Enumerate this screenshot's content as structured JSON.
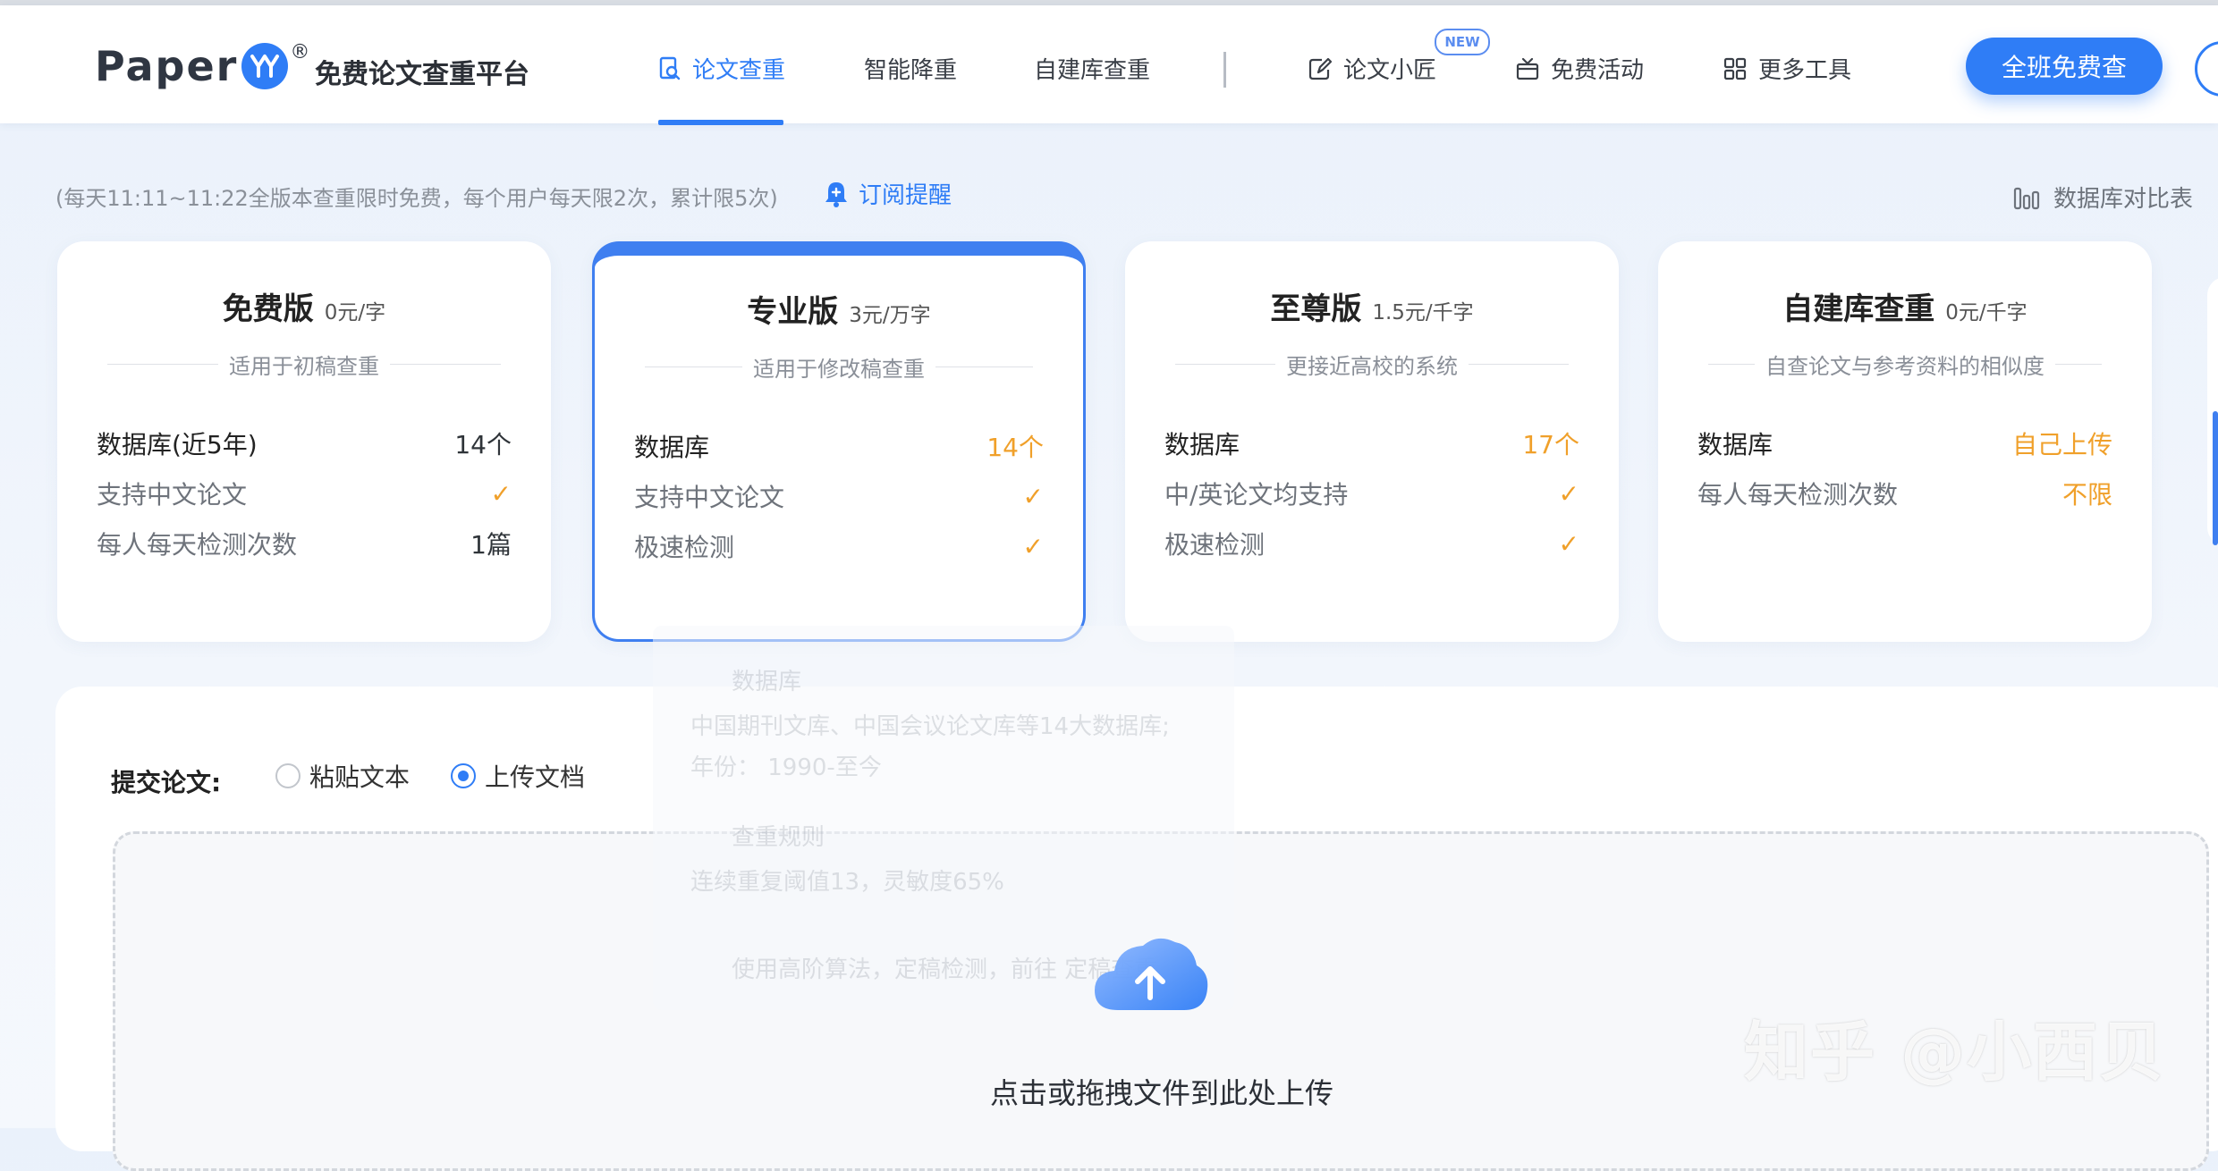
{
  "header": {
    "logo_text": "Paper",
    "slogan": "免费论文查重平台",
    "nav": [
      {
        "label": "论文查重",
        "active": true
      },
      {
        "label": "智能降重"
      },
      {
        "label": "自建库查重"
      },
      {
        "label": "论文小匠",
        "badge": "NEW"
      },
      {
        "label": "免费活动"
      },
      {
        "label": "更多工具"
      }
    ],
    "cta_label": "全班免费查"
  },
  "notice": {
    "text": "(每天11:11~11:22全版本查重限时免费，每个用户每天限2次，累计限5次)",
    "subscribe_label": "订阅提醒",
    "db_compare_label": "数据库对比表"
  },
  "plans": [
    {
      "name": "免费版",
      "price": "0元/字",
      "subtitle": "适用于初稿查重",
      "features": [
        {
          "label": "数据库(近5年)",
          "value": "14个"
        },
        {
          "label": "支持中文论文",
          "value": "✓"
        },
        {
          "label": "每人每天检测次数",
          "value": "1篇"
        }
      ]
    },
    {
      "name": "专业版",
      "price": "3元/万字",
      "subtitle": "适用于修改稿查重",
      "features": [
        {
          "label": "数据库",
          "value": "14个"
        },
        {
          "label": "支持中文论文",
          "value": "✓"
        },
        {
          "label": "极速检测",
          "value": "✓"
        }
      ]
    },
    {
      "name": "至尊版",
      "price": "1.5元/千字",
      "subtitle": "更接近高校的系统",
      "features": [
        {
          "label": "数据库",
          "value": "17个"
        },
        {
          "label": "中/英论文均支持",
          "value": "✓"
        },
        {
          "label": "极速检测",
          "value": "✓"
        }
      ]
    },
    {
      "name": "自建库查重",
      "price": "0元/千字",
      "subtitle": "自查论文与参考资料的相似度",
      "features": [
        {
          "label": "数据库",
          "value": "自己上传"
        },
        {
          "label": "每人每天检测次数",
          "value": "不限"
        }
      ]
    }
  ],
  "tooltip_ghost": {
    "title1": "数据库",
    "line1": "中国期刊文库、中国会议论文库等14大数据库;",
    "line2": "年份： 1990-至今",
    "title2": "查重规则",
    "line3": "连续重复阈值13，灵敏度65%",
    "line4": "使用高阶算法，定稿检测，前往 定稿查重"
  },
  "upload": {
    "submit_label": "提交论文:",
    "options": [
      {
        "label": "粘贴文本",
        "checked": false
      },
      {
        "label": "上传文档",
        "checked": true
      }
    ],
    "hint": "点击或拖拽文件到此处上传"
  },
  "watermark": "知乎 @小西贝",
  "colors": {
    "accent": "#2f7df6",
    "orange": "#f0a02a"
  }
}
